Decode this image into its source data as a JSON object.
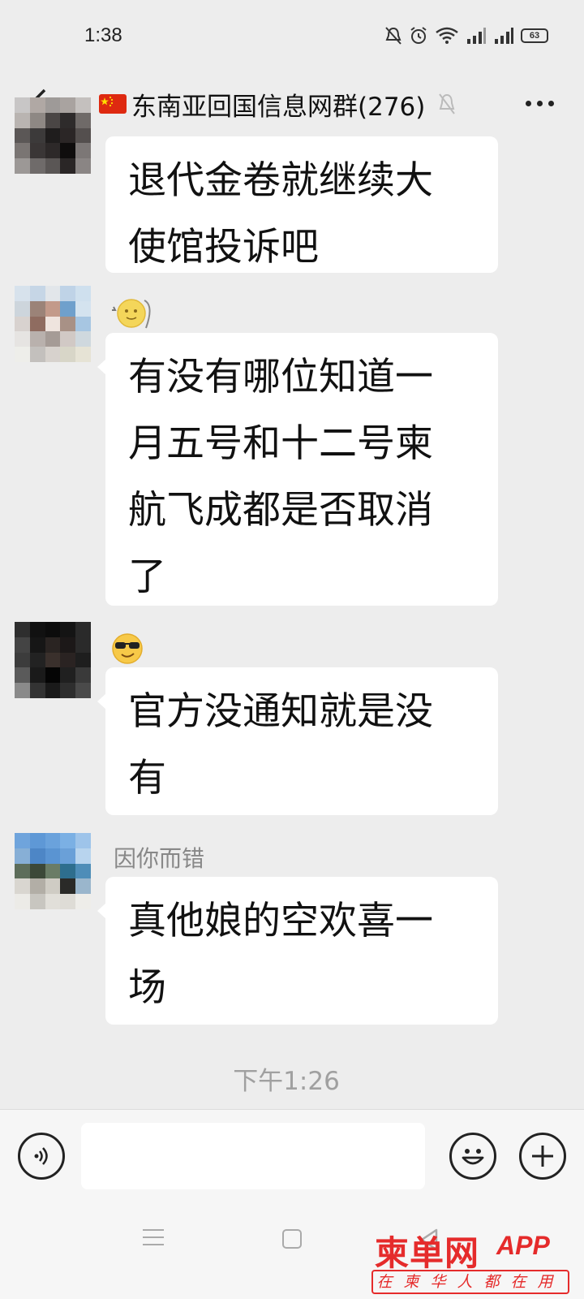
{
  "status_bar": {
    "time": "1:38",
    "battery": "63",
    "icons": [
      "mute-bell-icon",
      "alarm-icon",
      "wifi-icon",
      "signal-icon",
      "signal-icon",
      "battery-icon"
    ]
  },
  "header": {
    "title": "东南亚回国信息网群(276)",
    "back_icon": "chevron-left-icon",
    "flag_icon": "china-flag-icon",
    "muted_icon": "mute-icon",
    "more_icon": "more-dots-icon"
  },
  "messages": [
    {
      "sender": "",
      "text_lines": [
        "退代金卷就继续大",
        "使馆投诉吧"
      ]
    },
    {
      "sender": "",
      "sender_emoji": "moon-face-emoji",
      "text_lines": [
        "有没有哪位知道一",
        "月五号和十二号柬",
        "航飞成都是否取消",
        "了"
      ]
    },
    {
      "sender": "",
      "sender_emoji": "sunglasses-emoji",
      "text_lines": [
        "官方没通知就是没",
        "有"
      ]
    },
    {
      "sender": "因你而错",
      "text_lines": [
        "真他娘的空欢喜一",
        "场"
      ]
    }
  ],
  "timestamp": "下午1:26",
  "input_bar": {
    "value": "",
    "voice_icon": "voice-icon",
    "emoji_icon": "emoji-icon",
    "plus_icon": "plus-icon"
  },
  "watermark": {
    "brand": "柬单网",
    "app": "APP",
    "tagline": "在柬华人都在用"
  },
  "colors": {
    "background": "#ededed",
    "bubble": "#ffffff",
    "watermark": "#e52b2b"
  }
}
